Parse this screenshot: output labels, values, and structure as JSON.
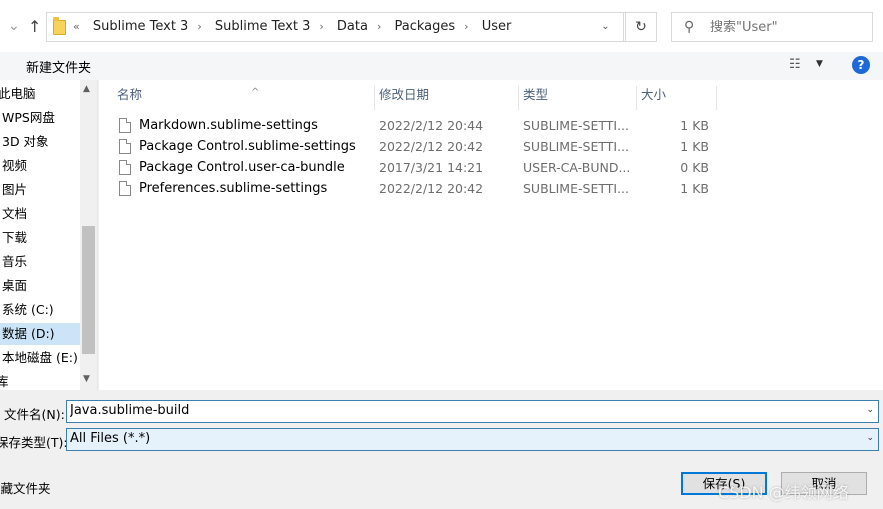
{
  "address_bar": {
    "crumbs": [
      "«",
      "Sublime Text 3",
      "Sublime Text 3",
      "Data",
      "Packages",
      "User"
    ],
    "search_placeholder": "搜索\"User\""
  },
  "toolbar": {
    "new_folder": "新建文件夹"
  },
  "nav": {
    "items": [
      {
        "label": "此电脑"
      },
      {
        "label": "WPS网盘"
      },
      {
        "label": "3D 对象"
      },
      {
        "label": "视频"
      },
      {
        "label": "图片"
      },
      {
        "label": "文档"
      },
      {
        "label": "下载"
      },
      {
        "label": "音乐"
      },
      {
        "label": "桌面"
      },
      {
        "label": "系统 (C:)"
      },
      {
        "label": "数据 (D:)"
      },
      {
        "label": "本地磁盘 (E:)"
      },
      {
        "label": "库"
      }
    ]
  },
  "columns": {
    "name": "名称",
    "date": "修改日期",
    "type": "类型",
    "size": "大小"
  },
  "files": [
    {
      "name": "Markdown.sublime-settings",
      "date": "2022/2/12 20:44",
      "type": "SUBLIME-SETTI...",
      "size": "1 KB"
    },
    {
      "name": "Package Control.sublime-settings",
      "date": "2022/2/12 20:42",
      "type": "SUBLIME-SETTI...",
      "size": "1 KB"
    },
    {
      "name": "Package Control.user-ca-bundle",
      "date": "2017/3/21 14:21",
      "type": "USER-CA-BUND...",
      "size": "0 KB"
    },
    {
      "name": "Preferences.sublime-settings",
      "date": "2022/2/12 20:42",
      "type": "SUBLIME-SETTI...",
      "size": "1 KB"
    }
  ],
  "bottom": {
    "filename_label": "文件名(N):",
    "filename_value": "Java.sublime-build",
    "filetype_label": "保存类型(T):",
    "filetype_value": "All Files (*.*)",
    "hide_folders": "隐藏文件夹",
    "save": "保存(S)",
    "cancel": "取消",
    "watermark": "CSDN @纬领网络"
  }
}
